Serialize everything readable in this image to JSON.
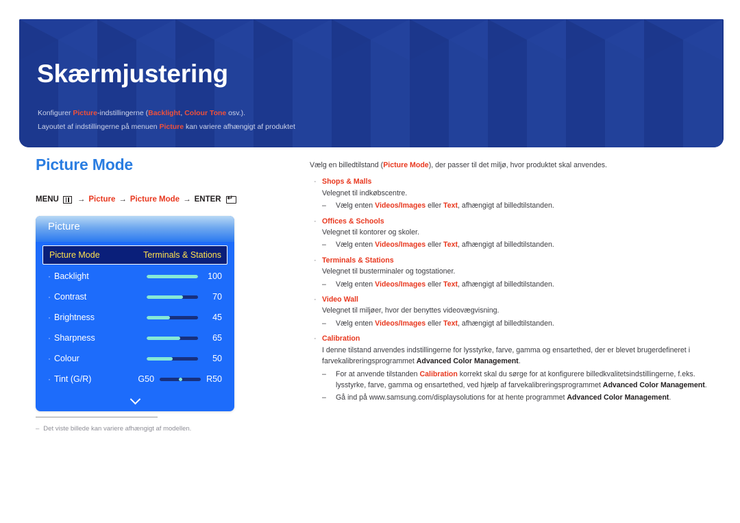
{
  "banner": {
    "title": "Skærmjustering",
    "sub1": {
      "p1": "Konfigurer ",
      "hl1": "Picture",
      "p2": "-indstillingerne (",
      "hl2": "Backlight",
      "p3": ", ",
      "hl3": "Colour Tone",
      "p4": " osv.)."
    },
    "sub2": {
      "p1": "Layoutet af indstillingerne på menuen ",
      "hl1": "Picture",
      "p2": " kan variere afhængigt af produktet"
    }
  },
  "left": {
    "section_title": "Picture Mode",
    "menu_path": {
      "menu_label": "MENU",
      "menu_icon": "menu-grid-icon",
      "arrow1": "→",
      "step1": "Picture",
      "arrow2": "→",
      "step2": "Picture Mode",
      "arrow3": "→",
      "enter_label": "ENTER",
      "enter_icon": "enter-key-icon"
    },
    "osd": {
      "header": "Picture",
      "selected_row": {
        "label": "Picture Mode",
        "value": "Terminals & Stations"
      },
      "rows": [
        {
          "label": "Backlight",
          "value": "100",
          "percent": 100
        },
        {
          "label": "Contrast",
          "value": "70",
          "percent": 70
        },
        {
          "label": "Brightness",
          "value": "45",
          "percent": 45
        },
        {
          "label": "Sharpness",
          "value": "65",
          "percent": 65
        },
        {
          "label": "Colour",
          "value": "50",
          "percent": 50
        }
      ],
      "tint": {
        "label": "Tint (G/R)",
        "left": "G50",
        "right": "R50",
        "position": 50
      },
      "scroll_icon": "chevron-down-icon"
    },
    "footnote": {
      "dash": "‒",
      "text": "Det viste billede kan variere afhængigt af modellen."
    }
  },
  "right": {
    "intro": {
      "p1": "Vælg en billedtilstand (",
      "hl": "Picture Mode",
      "p2": "), der passer til det miljø, hvor produktet skal anvendes."
    },
    "bullet_char": "·",
    "dash_char": "‒",
    "items": [
      {
        "title": "Shops & Malls",
        "desc": "Velegnet til indkøbscentre.",
        "sub": [
          {
            "p1": "Vælg enten ",
            "b1": "Videos/Images",
            "p2": " eller ",
            "b2": "Text",
            "p3": ", afhængigt af billedtilstanden."
          }
        ]
      },
      {
        "title": "Offices & Schools",
        "desc": "Velegnet til kontorer og skoler.",
        "sub": [
          {
            "p1": "Vælg enten ",
            "b1": "Videos/Images",
            "p2": " eller ",
            "b2": "Text",
            "p3": ", afhængigt af billedtilstanden."
          }
        ]
      },
      {
        "title": "Terminals & Stations",
        "desc": "Velegnet til busterminaler og togstationer.",
        "sub": [
          {
            "p1": "Vælg enten ",
            "b1": "Videos/Images",
            "p2": " eller ",
            "b2": "Text",
            "p3": ", afhængigt af billedtilstanden."
          }
        ]
      },
      {
        "title": "Video Wall",
        "desc": "Velegnet til miljøer, hvor der benyttes videovægvisning.",
        "sub": [
          {
            "p1": "Vælg enten ",
            "b1": "Videos/Images",
            "p2": " eller ",
            "b2": "Text",
            "p3": ", afhængigt af billedtilstanden."
          }
        ]
      }
    ],
    "calibration": {
      "title": "Calibration",
      "desc_p1": "I denne tilstand anvendes indstillingerne for lysstyrke, farve, gamma og ensartethed, der er blevet brugerdefineret i farvekalibreringsprogrammet ",
      "desc_b1": "Advanced Color Management",
      "desc_p2": ".",
      "sub": [
        {
          "p1": "For at anvende tilstanden ",
          "r1": "Calibration",
          "p2": " korrekt skal du sørge for at konfigurere billedkvalitetsindstillingerne, f.eks. lysstyrke, farve, gamma og ensartethed, ved hjælp af farvekalibreringsprogrammet ",
          "b1": "Advanced Color Management",
          "p3": "."
        },
        {
          "p1": "Gå ind på www.samsung.com/displaysolutions for at hente programmet ",
          "b1": "Advanced Color Management",
          "p3": "."
        }
      ]
    }
  },
  "colors": {
    "banner_bg": "#1f3d96",
    "accent_red": "#e8381f",
    "section_blue": "#2a7de1",
    "osd_blue": "#1d6cfb",
    "osd_selected": "#0a1f7a",
    "osd_yellow": "#ffe14d",
    "slider_fill": "#86e9d6"
  }
}
